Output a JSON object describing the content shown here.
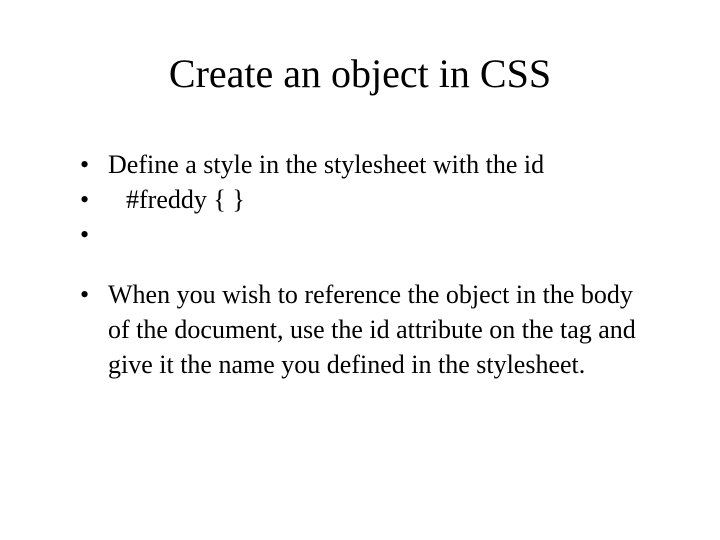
{
  "title": "Create an object in CSS",
  "bullets": {
    "b1": "Define a style in the stylesheet with the id",
    "b2": "#freddy { }",
    "b3": "When you wish to reference the object in the body of the document, use the id attribute on the tag and give it the name you defined in the stylesheet."
  }
}
